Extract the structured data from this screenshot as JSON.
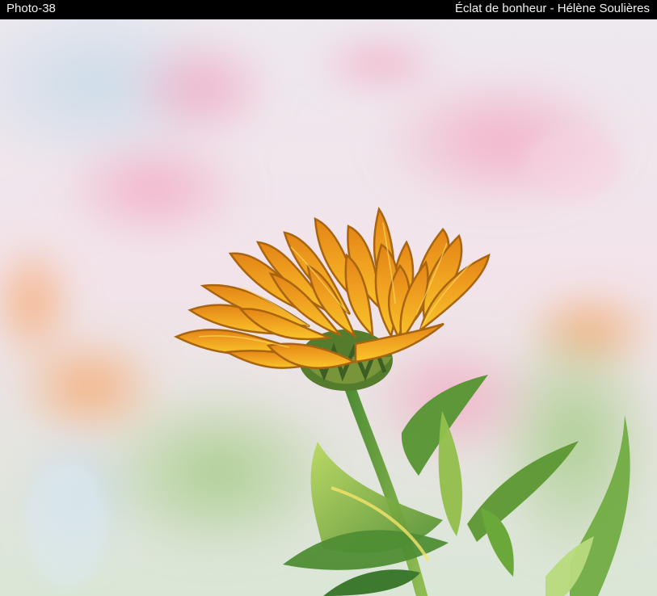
{
  "caption": {
    "photo_id": "Photo-38",
    "title": "Éclat de bonheur - Hélène Soulières"
  },
  "photo": {
    "subject": "flower-photo"
  },
  "colors": {
    "caption_background": "#000000",
    "caption_text": "#f2f2f2",
    "petal_orange": "#f0a020",
    "petal_dark": "#b86a10",
    "leaf_green": "#4d8b2f",
    "blur_pink": "#f2b8cc"
  }
}
